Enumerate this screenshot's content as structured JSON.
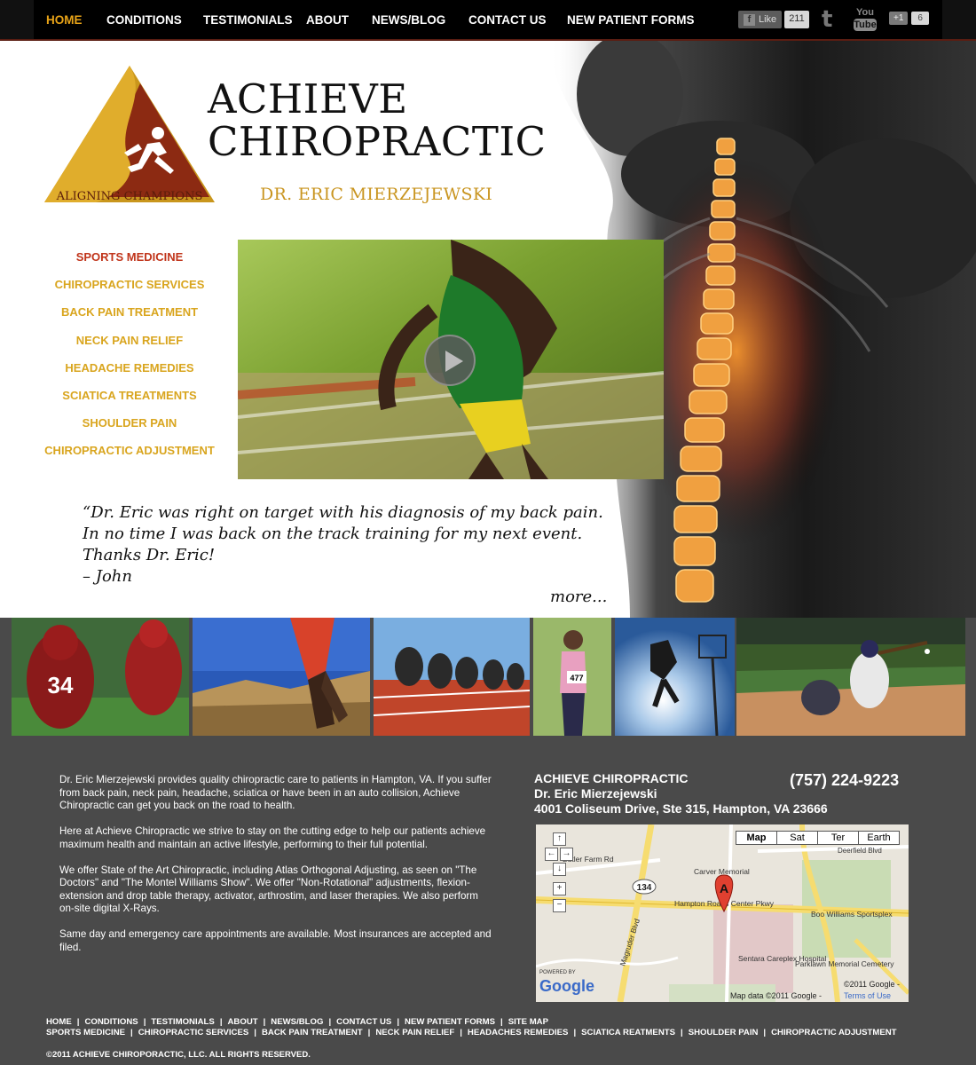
{
  "nav": {
    "items": [
      "HOME",
      "CONDITIONS",
      "TESTIMONIALS",
      "ABOUT",
      "NEWS/BLOG",
      "CONTACT US",
      "NEW PATIENT FORMS"
    ],
    "fb_like_label": "Like",
    "fb_like_count": "211",
    "youtube_top": "You",
    "youtube_bottom": "Tube",
    "gplus_label": "+1",
    "gplus_count": "6"
  },
  "brand": {
    "line1": "ACHIEVE",
    "line2": "CHIROPRACTIC",
    "tagline": "ALIGNING CHAMPIONS",
    "doctor": "DR. ERIC MIERZEJEWSKI"
  },
  "services": [
    "SPORTS MEDICINE",
    "CHIROPRACTIC SERVICES",
    "BACK PAIN TREATMENT",
    "NECK PAIN RELIEF",
    "HEADACHE REMEDIES",
    "SCIATICA TREATMENTS",
    "SHOULDER PAIN",
    "CHIROPRACTIC ADJUSTMENT"
  ],
  "testimonial": {
    "line1": "“Dr. Eric was right on target with his diagnosis of my back pain.",
    "line2": "In no time I was back on the track training for my next event.",
    "line3": "Thanks Dr. Eric!",
    "line4": "– John",
    "more": "more..."
  },
  "about": {
    "p1": "Dr. Eric Mierzejewski provides quality chiropractic care to patients in Hampton, VA. If you suffer from back pain, neck pain, headache, sciatica or have been in an auto collision, Achieve Chiropractic can get you back on the road to health.",
    "p2": "Here at Achieve Chiropractic we strive to stay on the cutting edge to help our patients achieve maximum health and maintain an active lifestyle, performing to their full potential.",
    "p3": "We offer State of the Art Chiropractic, including Atlas Orthogonal Adjusting, as seen on \"The Doctors\" and \"The Montel Williams Show\".  We offer \"Non-Rotational\" adjustments, flexion-extension and drop table therapy, activator, arthrostim, and laser therapies.  We also perform on-site digital X-Rays.",
    "p4": "Same day and emergency care appointments are available.  Most insurances are accepted and filed."
  },
  "contact": {
    "name": "ACHIEVE CHIROPRACTIC",
    "doctor": "Dr. Eric Mierzejewski",
    "address": "4001 Coliseum Drive, Ste 315, Hampton, VA 23666",
    "phone": "(757) 224-9223"
  },
  "map": {
    "types": [
      "Map",
      "Sat",
      "Ter",
      "Earth"
    ],
    "labels": {
      "butler": "Butler Farm Rd",
      "deerfield": "Deerfield Blvd",
      "route": "134",
      "carver": "Carver Memorial",
      "hampton_pkwy": "Hampton Roads Center Pkwy",
      "boo": "Boo Williams Sportsplex",
      "magruder": "Magruder Blvd",
      "sentara": "Sentara Careplex Hospital",
      "parklawn": "Parklawn Memorial Cemetery",
      "marker": "A",
      "powered": "POWERED BY",
      "google": "Google",
      "copy": "©2011 Google -",
      "mapdata": "Map data ©2011 Google -",
      "terms": "Terms of Use"
    }
  },
  "footer": {
    "row1": [
      "HOME",
      "CONDITIONS",
      "TESTIMONIALS",
      "ABOUT",
      "NEWS/BLOG",
      "CONTACT US",
      "NEW PATIENT FORMS",
      "SITE MAP"
    ],
    "row2": [
      "SPORTS MEDICINE",
      "CHIROPRACTIC SERVICES",
      "BACK PAIN TREATMENT",
      "NECK PAIN RELIEF",
      "HEADACHES REMEDIES",
      "SCIATICA REATMENTS",
      "SHOULDER PAIN",
      "CHIROPRACTIC ADJUSTMENT"
    ],
    "copyright": "©2011 ACHIEVE CHIROPORACTIC, LLC. ALL RIGHTS RESERVED."
  },
  "colors": {
    "accent_gold": "#d9a51e",
    "accent_red": "#c0341a",
    "nav_active": "#e8a317",
    "footer_bg": "#4a4a4a"
  }
}
